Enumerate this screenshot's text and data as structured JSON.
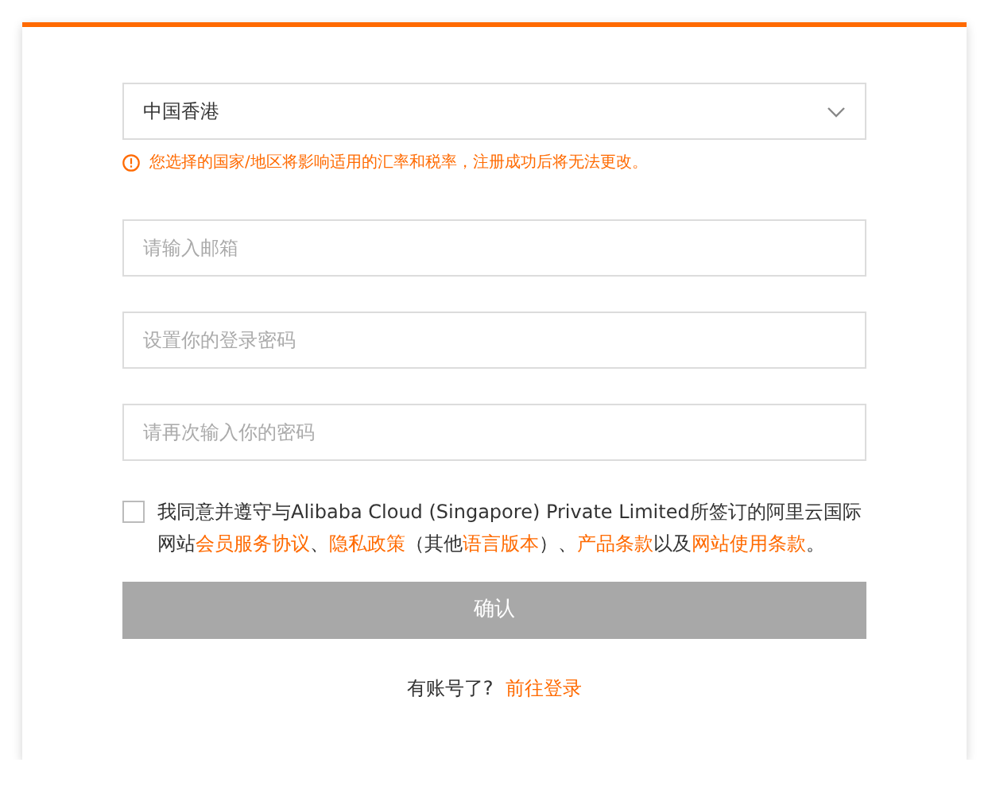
{
  "region_select": {
    "value": "中国香港",
    "notice": "您选择的国家/地区将影响适用的汇率和税率，注册成功后将无法更改。"
  },
  "fields": [
    {
      "placeholder": "请输入邮箱"
    },
    {
      "placeholder": "设置你的登录密码"
    },
    {
      "placeholder": "请再次输入你的密码"
    }
  ],
  "agreement": {
    "checked": false,
    "segments": [
      {
        "kind": "text",
        "text": "我同意并遵守与Alibaba Cloud (Singapore) Private Limited所签订的阿里云国际网站"
      },
      {
        "kind": "link",
        "text": "会员服务协议"
      },
      {
        "kind": "text",
        "text": "、"
      },
      {
        "kind": "link",
        "text": "隐私政策"
      },
      {
        "kind": "text",
        "text": "（其他"
      },
      {
        "kind": "link",
        "text": "语言版本"
      },
      {
        "kind": "text",
        "text": "）、"
      },
      {
        "kind": "link",
        "text": "产品条款"
      },
      {
        "kind": "text",
        "text": "以及"
      },
      {
        "kind": "link",
        "text": "网站使用条款"
      },
      {
        "kind": "text",
        "text": "。"
      }
    ]
  },
  "confirm_button": {
    "label": "确认",
    "disabled": true
  },
  "login_prompt": {
    "text": "有账号了?",
    "link": "前往登录"
  }
}
